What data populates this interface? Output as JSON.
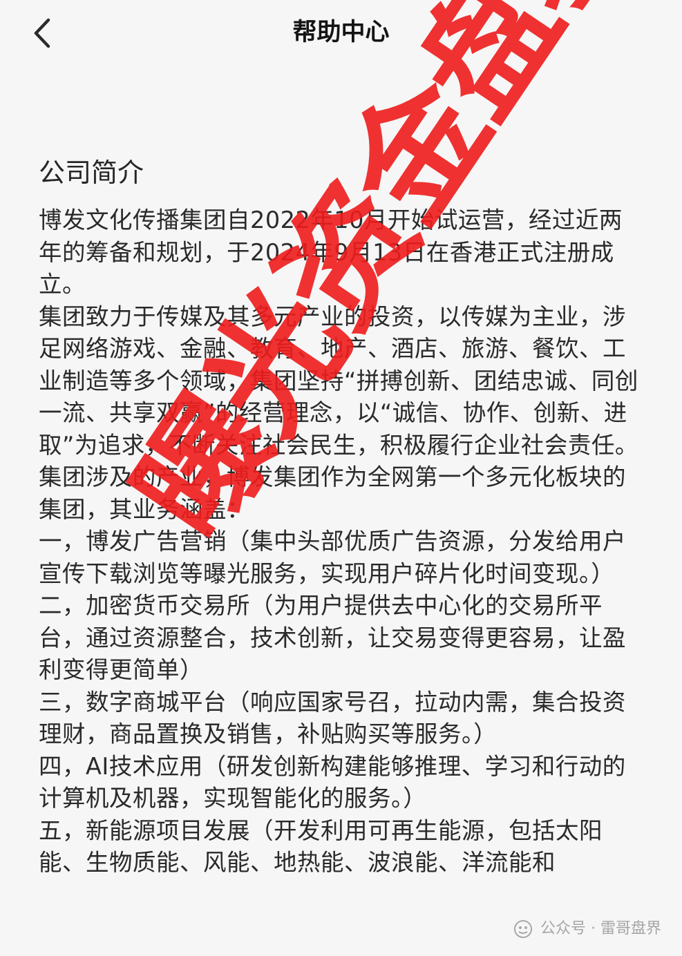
{
  "nav": {
    "title": "帮助中心"
  },
  "section": {
    "title": "公司简介"
  },
  "paragraphs": [
    "博发文化传播集团自2022年10月开始试运营，经过近两年的筹备和规划，于2024年9月13日在香港正式注册成立。",
    "集团致力于传媒及其多元产业的投资，以传媒为主业，涉足网络游戏、金融、教育、地产、酒店、旅游、餐饮、工业制造等多个领域，集团坚持“拼搏创新、团结忠诚、同创一流、共享双赢”的经营理念，以“诚信、协作、创新、进取”为追求，不断关注社会民生，积极履行企业社会责任。",
    "集团涉及的产业，博发集团作为全网第一个多元化板块的集团，其业务涵盖：",
    "一，博发广告营销（集中头部优质广告资源，分发给用户宣传下载浏览等曝光服务，实现用户碎片化时间变现。）",
    "二，加密货币交易所（为用户提供去中心化的交易所平台，通过资源整合，技术创新，让交易变得更容易，让盈利变得更简单）",
    "三，数字商城平台（响应国家号召，拉动内需，集合投资理财，商品置换及销售，补贴购买等服务。）",
    "四，AI技术应用（研发创新构建能够推理、学习和行动的计算机及机器，实现智能化的服务。）",
    "五，新能源项目发展（开发利用可再生能源，包括太阳能、生物质能、风能、地热能、波浪能、洋流能和"
  ],
  "stamp": {
    "text": "曝光资金盘骗局",
    "color": "#ee1c1c"
  },
  "watermark": {
    "text": "公众号 · 雷哥盘界",
    "icon": "wechat-official-account-icon"
  }
}
